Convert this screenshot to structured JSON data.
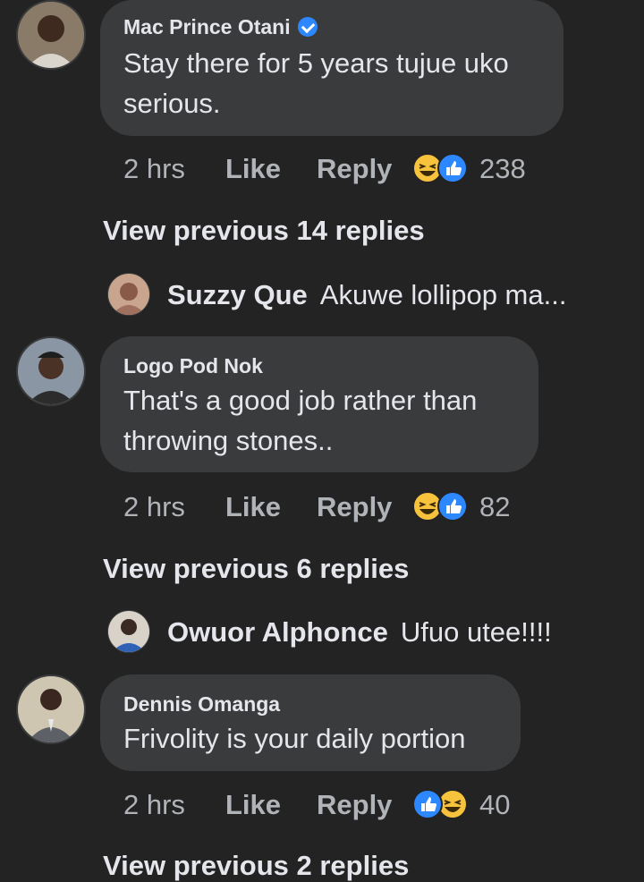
{
  "comments": [
    {
      "author": "Mac Prince Otani",
      "verified": true,
      "text_lines": [
        "Stay there for 5 years tujue uko",
        "serious."
      ],
      "time": "2 hrs",
      "like_label": "Like",
      "reply_label": "Reply",
      "reactions": [
        "haha-icon",
        "like-icon"
      ],
      "reaction_count": "238",
      "view_previous": "View previous 14 replies",
      "latest_reply": {
        "author": "Suzzy Que",
        "text": "Akuwe  lollipop ma..."
      }
    },
    {
      "author": "Logo Pod Nok",
      "verified": false,
      "text_lines": [
        "That's  a good job rather than",
        "throwing stones.."
      ],
      "time": "2 hrs",
      "like_label": "Like",
      "reply_label": "Reply",
      "reactions": [
        "haha-icon",
        "like-icon"
      ],
      "reaction_count": "82",
      "view_previous": "View previous 6 replies",
      "latest_reply": {
        "author": "Owuor Alphonce",
        "text": "Ufuo utee!!!!"
      }
    },
    {
      "author": "Dennis Omanga",
      "verified": false,
      "text_lines": [
        "Frivolity is your daily portion"
      ],
      "time": "2 hrs",
      "like_label": "Like",
      "reply_label": "Reply",
      "reactions": [
        "like-icon",
        "haha-icon"
      ],
      "reaction_count": "40",
      "view_previous": "View previous 2 replies"
    }
  ],
  "colors": {
    "background": "#232323",
    "bubble": "#3a3b3c",
    "like_blue": "#2d88ff",
    "haha_yellow": "#f7c33d",
    "muted_text": "#b0b3b8"
  }
}
